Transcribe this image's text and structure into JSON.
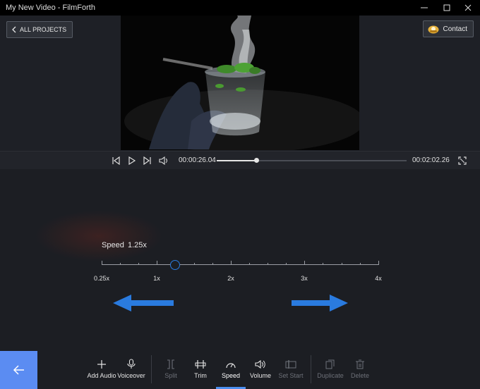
{
  "window": {
    "title": "My New Video - FilmForth",
    "minimize_icon": "minimize-icon",
    "maximize_icon": "maximize-icon",
    "close_icon": "close-icon"
  },
  "header": {
    "back_label": "ALL PROJECTS",
    "contact_label": "Contact"
  },
  "player": {
    "current_time": "00:00:26.04",
    "total_time": "00:02:02.26",
    "progress_fraction": 0.21
  },
  "speed_panel": {
    "label": "Speed",
    "value": "1.25x",
    "slider_value": 1.25,
    "tick_labels": [
      "0.25x",
      "1x",
      "2x",
      "3x",
      "4x"
    ]
  },
  "toolbar": {
    "items": [
      {
        "label": "Add Audio",
        "icon": "plus-icon",
        "state": "enabled"
      },
      {
        "label": "Voiceover",
        "icon": "microphone-icon",
        "state": "enabled"
      },
      {
        "label": "Split",
        "icon": "split-icon",
        "state": "disabled"
      },
      {
        "label": "Trim",
        "icon": "trim-icon",
        "state": "enabled"
      },
      {
        "label": "Speed",
        "icon": "speed-icon",
        "state": "active"
      },
      {
        "label": "Volume",
        "icon": "volume-icon",
        "state": "enabled"
      },
      {
        "label": "Set Start",
        "icon": "set-start-icon",
        "state": "disabled"
      },
      {
        "label": "Duplicate",
        "icon": "duplicate-icon",
        "state": "disabled"
      },
      {
        "label": "Delete",
        "icon": "trash-icon",
        "state": "disabled"
      }
    ]
  },
  "colors": {
    "accent": "#2a7bdf",
    "back_button": "#5b8cf2",
    "arrow": "#2a7bdf"
  }
}
